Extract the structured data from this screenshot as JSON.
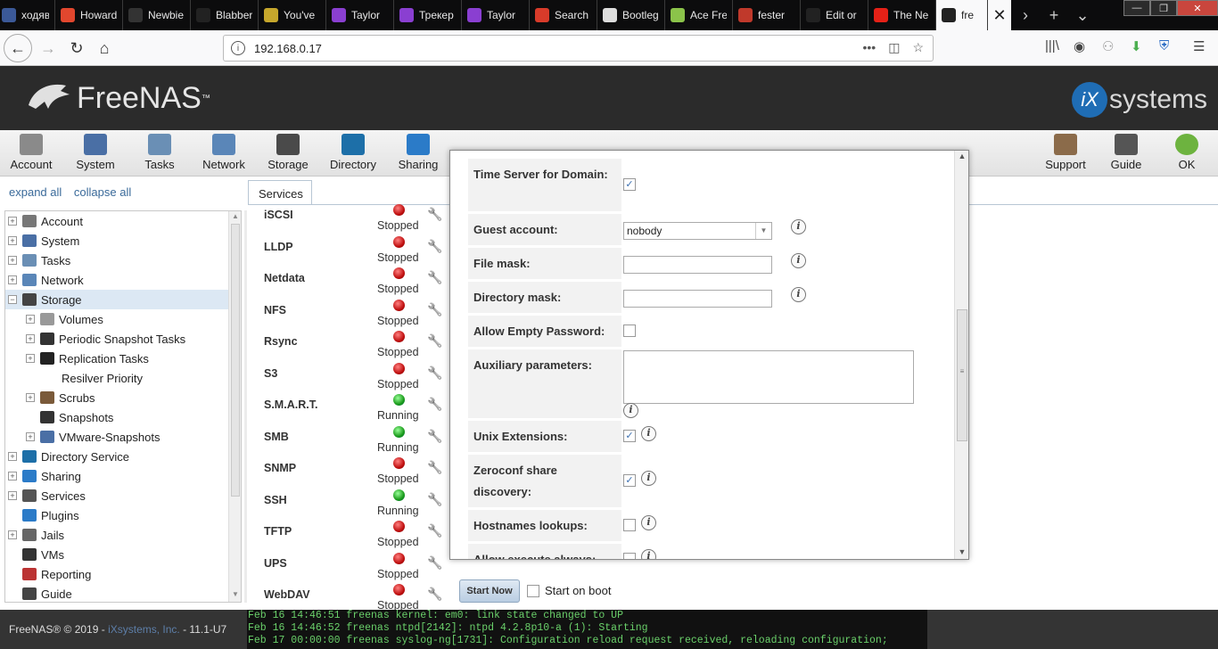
{
  "browser": {
    "tabs": [
      {
        "title": "ходяв",
        "color": "#3b5998"
      },
      {
        "title": "Howard",
        "color": "#e2472e"
      },
      {
        "title": "Newbie",
        "color": "#333333"
      },
      {
        "title": "Blabber",
        "color": "#222222"
      },
      {
        "title": "You've",
        "color": "#c6a72c"
      },
      {
        "title": "Taylor",
        "color": "#8a3fd1"
      },
      {
        "title": "Трекер",
        "color": "#8a3fd1"
      },
      {
        "title": "Taylor",
        "color": "#8a3fd1"
      },
      {
        "title": "Search",
        "color": "#d83b2a"
      },
      {
        "title": "Bootleg",
        "color": "#dddddd"
      },
      {
        "title": "Ace Fre",
        "color": "#8bc34a"
      },
      {
        "title": "fester",
        "color": "#c0392b"
      },
      {
        "title": "Edit or",
        "color": "#222222"
      },
      {
        "title": "The Ne",
        "color": "#e62117"
      }
    ],
    "active_tab": {
      "title": "fre"
    },
    "url": "192.168.0.17"
  },
  "brand": {
    "product": "FreeNAS",
    "tm": "™",
    "vendor_ix": "iX",
    "vendor_rest": "systems"
  },
  "toolbar": {
    "items": [
      "Account",
      "System",
      "Tasks",
      "Network",
      "Storage",
      "Directory",
      "Sharing"
    ],
    "right_items": [
      "Support",
      "Guide",
      "OK"
    ]
  },
  "tree": {
    "expand_all": "expand all",
    "collapse_all": "collapse all",
    "items": [
      {
        "label": "Account",
        "level": 0,
        "expander": "+",
        "icon": "users-icon"
      },
      {
        "label": "System",
        "level": 0,
        "expander": "+",
        "icon": "system-icon"
      },
      {
        "label": "Tasks",
        "level": 0,
        "expander": "+",
        "icon": "clock-icon"
      },
      {
        "label": "Network",
        "level": 0,
        "expander": "+",
        "icon": "network-icon"
      },
      {
        "label": "Storage",
        "level": 0,
        "expander": "−",
        "icon": "folder-icon",
        "selected": true
      },
      {
        "label": "Volumes",
        "level": 1,
        "expander": "+",
        "icon": "disk-icon"
      },
      {
        "label": "Periodic Snapshot Tasks",
        "level": 1,
        "expander": "+",
        "icon": "camera-icon"
      },
      {
        "label": "Replication Tasks",
        "level": 1,
        "expander": "+",
        "icon": "grid-icon"
      },
      {
        "label": "Resilver Priority",
        "level": 1,
        "expander": "",
        "icon": ""
      },
      {
        "label": "Scrubs",
        "level": 1,
        "expander": "+",
        "icon": "broom-icon"
      },
      {
        "label": "Snapshots",
        "level": 1,
        "expander": "",
        "icon": "camera-icon"
      },
      {
        "label": "VMware-Snapshots",
        "level": 1,
        "expander": "+",
        "icon": "vm-icon"
      },
      {
        "label": "Directory Service",
        "level": 0,
        "expander": "+",
        "icon": "directory-icon"
      },
      {
        "label": "Sharing",
        "level": 0,
        "expander": "+",
        "icon": "sharing-icon"
      },
      {
        "label": "Services",
        "level": 0,
        "expander": "+",
        "icon": "gears-icon"
      },
      {
        "label": "Plugins",
        "level": 0,
        "expander": "",
        "icon": "puzzle-icon"
      },
      {
        "label": "Jails",
        "level": 0,
        "expander": "+",
        "icon": "jail-icon"
      },
      {
        "label": "VMs",
        "level": 0,
        "expander": "",
        "icon": "monitor-icon"
      },
      {
        "label": "Reporting",
        "level": 0,
        "expander": "",
        "icon": "chart-icon"
      },
      {
        "label": "Guide",
        "level": 0,
        "expander": "",
        "icon": "book-icon"
      }
    ]
  },
  "services": {
    "tab_label": "Services",
    "rows": [
      {
        "name": "iSCSI",
        "status": "Stopped",
        "running": false
      },
      {
        "name": "LLDP",
        "status": "Stopped",
        "running": false
      },
      {
        "name": "Netdata",
        "status": "Stopped",
        "running": false
      },
      {
        "name": "NFS",
        "status": "Stopped",
        "running": false
      },
      {
        "name": "Rsync",
        "status": "Stopped",
        "running": false
      },
      {
        "name": "S3",
        "status": "Stopped",
        "running": false
      },
      {
        "name": "S.M.A.R.T.",
        "status": "Running",
        "running": true
      },
      {
        "name": "SMB",
        "status": "Running",
        "running": true
      },
      {
        "name": "SNMP",
        "status": "Stopped",
        "running": false
      },
      {
        "name": "SSH",
        "status": "Running",
        "running": true
      },
      {
        "name": "TFTP",
        "status": "Stopped",
        "running": false
      },
      {
        "name": "UPS",
        "status": "Stopped",
        "running": false
      },
      {
        "name": "WebDAV",
        "status": "Stopped",
        "running": false
      }
    ],
    "start_now": "Start Now",
    "start_on_boot": "Start on boot"
  },
  "modal": {
    "fields": [
      {
        "label": "Time Server for Domain:",
        "type": "checkbox",
        "checked": true
      },
      {
        "label": "Guest account:",
        "type": "select",
        "value": "nobody"
      },
      {
        "label": "File mask:",
        "type": "text",
        "value": ""
      },
      {
        "label": "Directory mask:",
        "type": "text",
        "value": ""
      },
      {
        "label": "Allow Empty Password:",
        "type": "checkbox",
        "checked": false
      },
      {
        "label": "Auxiliary parameters:",
        "type": "textarea",
        "value": ""
      },
      {
        "label": "Unix Extensions:",
        "type": "checkbox",
        "checked": true
      },
      {
        "label": "Zeroconf share discovery:",
        "type": "checkbox",
        "checked": true
      },
      {
        "label": "Hostnames lookups:",
        "type": "checkbox",
        "checked": false
      },
      {
        "label": "Allow execute always:",
        "type": "checkbox",
        "checked": false
      }
    ]
  },
  "footer": {
    "copyright_prefix": "FreeNAS® © 2019 - ",
    "company": "iXsystems, Inc.",
    "version": " - 11.1-U7"
  },
  "console_log": [
    "Feb 16 14:46:51 freenas kernel: em0: link state changed to UP",
    "Feb 16 14:46:52 freenas ntpd[2142]: ntpd 4.2.8p10-a (1): Starting",
    "Feb 17 00:00:00 freenas syslog-ng[1731]: Configuration reload request received, reloading configuration;"
  ]
}
